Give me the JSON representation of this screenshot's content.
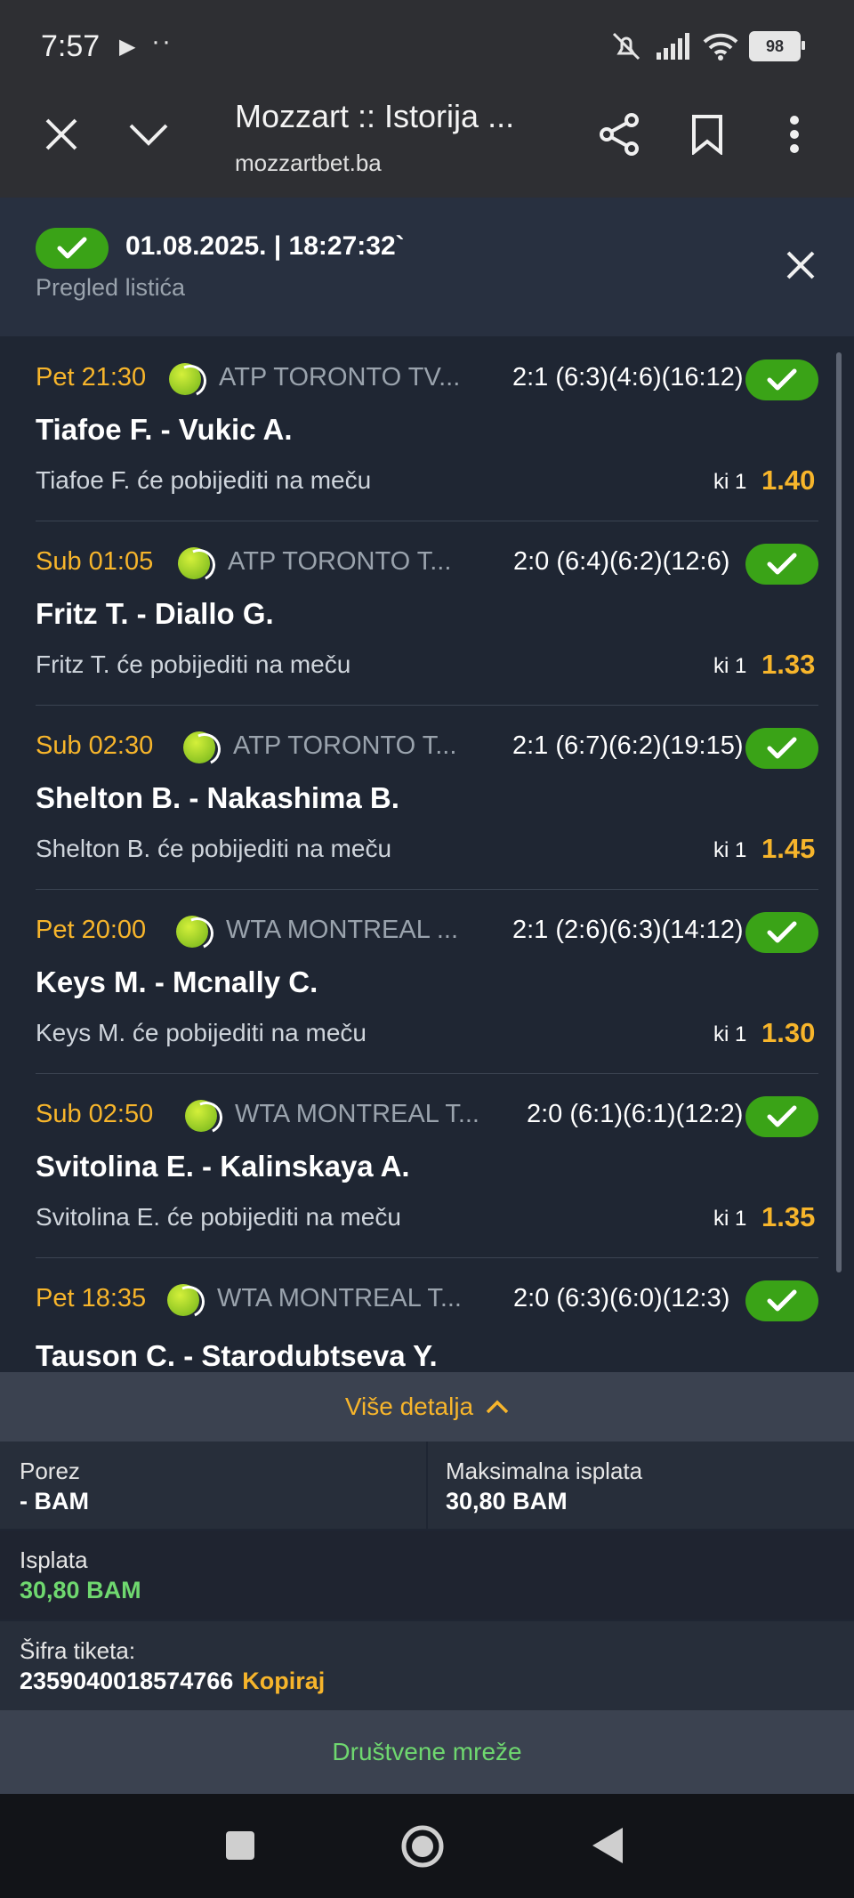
{
  "status": {
    "time": "7:57",
    "battery": "98"
  },
  "browser": {
    "title": "Mozzart :: Istorija ...",
    "url": "mozzartbet.ba"
  },
  "ticket": {
    "datetime": "01.08.2025. | 18:27:32`",
    "subtitle": "Pregled listića"
  },
  "items": [
    {
      "time": "Pet 21:30",
      "league": "ATP TORONTO TV...",
      "score": "2:1 (6:3)(4:6)(16:12)",
      "match": "Tiafoe F. - Vukic A.",
      "pick": "Tiafoe F. će pobijediti na meču",
      "ki": "ki 1",
      "odd": "1.40"
    },
    {
      "time": "Sub 01:05",
      "league": "ATP TORONTO T...",
      "score": "2:0 (6:4)(6:2)(12:6)",
      "match": "Fritz T. - Diallo G.",
      "pick": "Fritz T. će pobijediti na meču",
      "ki": "ki 1",
      "odd": "1.33"
    },
    {
      "time": "Sub 02:30",
      "league": "ATP TORONTO T...",
      "score": "2:1 (6:7)(6:2)(19:15)",
      "match": "Shelton B. - Nakashima B.",
      "pick": "Shelton B. će pobijediti na meču",
      "ki": "ki 1",
      "odd": "1.45"
    },
    {
      "time": "Pet 20:00",
      "league": "WTA MONTREAL ...",
      "score": "2:1 (2:6)(6:3)(14:12)",
      "match": "Keys M. - Mcnally C.",
      "pick": "Keys M. će pobijediti na meču",
      "ki": "ki 1",
      "odd": "1.30"
    },
    {
      "time": "Sub 02:50",
      "league": "WTA MONTREAL T...",
      "score": "2:0 (6:1)(6:1)(12:2)",
      "match": "Svitolina E. - Kalinskaya A.",
      "pick": "Svitolina E. će pobijediti na meču",
      "ki": "ki 1",
      "odd": "1.35"
    },
    {
      "time": "Pet 18:35",
      "league": "WTA MONTREAL T...",
      "score": "2:0 (6:3)(6:0)(12:3)",
      "match": "Tauson C. - Starodubtseva Y.",
      "pick": "",
      "ki": "",
      "odd": ""
    }
  ],
  "details": {
    "more_label": "Više detalja",
    "tax_label": "Porez",
    "tax_value": "- BAM",
    "max_payout_label": "Maksimalna isplata",
    "max_payout_value": "30,80 BAM",
    "payout_label": "Isplata",
    "payout_value": "30,80 BAM",
    "code_label": "Šifra tiketa:",
    "code_value": "2359040018574766",
    "copy_label": "Kopiraj",
    "social_label": "Društvene mreže"
  }
}
